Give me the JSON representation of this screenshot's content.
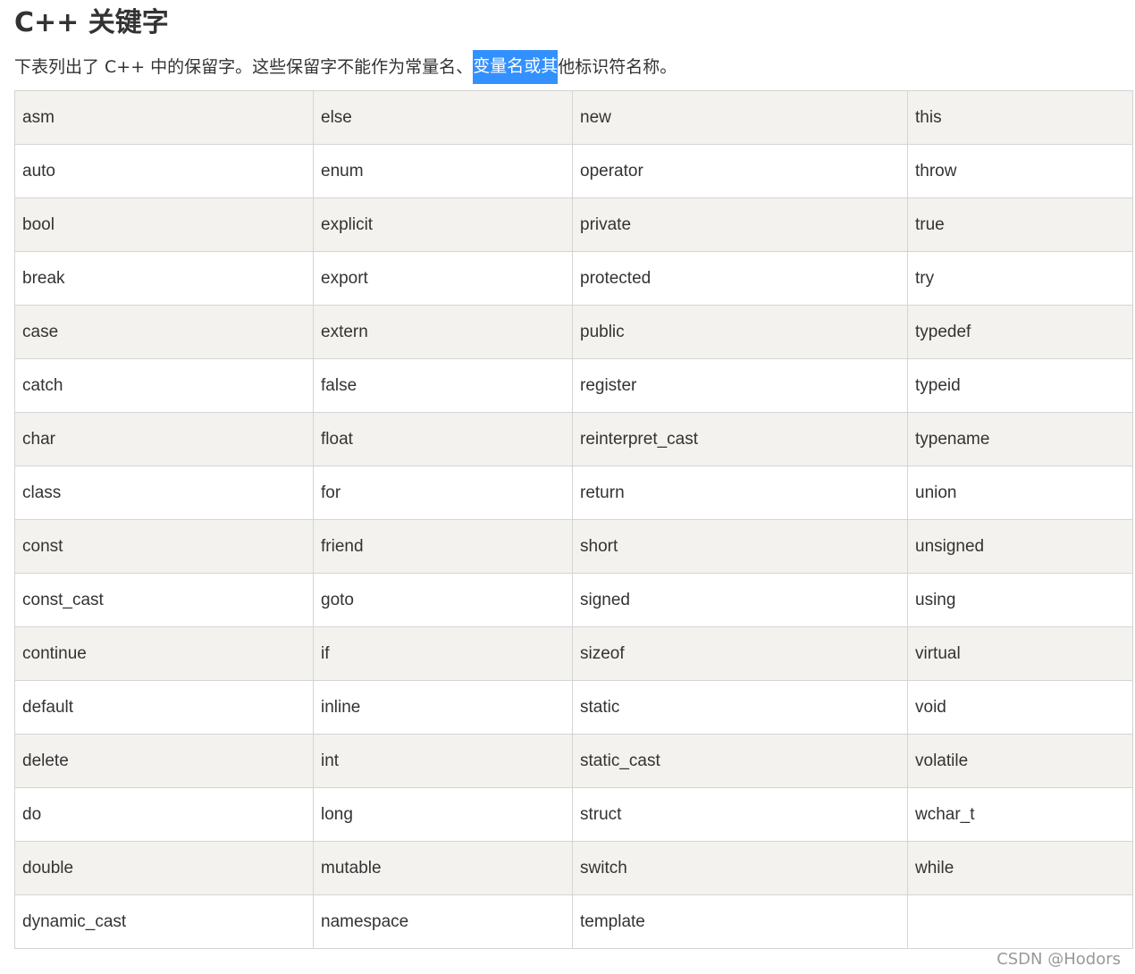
{
  "title": "C++ 关键字",
  "intro": {
    "before": "下表列出了 C++ 中的保留字。这些保留字不能作为常量名、",
    "highlighted": "变量名或其",
    "after": "他标识符名称。"
  },
  "table": {
    "rows": [
      [
        "asm",
        "else",
        "new",
        "this"
      ],
      [
        "auto",
        "enum",
        "operator",
        "throw"
      ],
      [
        "bool",
        "explicit",
        "private",
        "true"
      ],
      [
        "break",
        "export",
        "protected",
        "try"
      ],
      [
        "case",
        "extern",
        "public",
        "typedef"
      ],
      [
        "catch",
        "false",
        "register",
        "typeid"
      ],
      [
        "char",
        "float",
        "reinterpret_cast",
        "typename"
      ],
      [
        "class",
        "for",
        "return",
        "union"
      ],
      [
        "const",
        "friend",
        "short",
        "unsigned"
      ],
      [
        "const_cast",
        "goto",
        "signed",
        "using"
      ],
      [
        "continue",
        "if",
        "sizeof",
        "virtual"
      ],
      [
        "default",
        "inline",
        "static",
        "void"
      ],
      [
        "delete",
        "int",
        "static_cast",
        "volatile"
      ],
      [
        "do",
        "long",
        "struct",
        "wchar_t"
      ],
      [
        "double",
        "mutable",
        "switch",
        "while"
      ],
      [
        "dynamic_cast",
        "namespace",
        "template",
        ""
      ]
    ]
  },
  "watermark": "CSDN @Hodors",
  "colors": {
    "text": "#333333",
    "stripe": "#f3f2ee",
    "border": "#d4d4d4",
    "selection": "#3390ff"
  }
}
